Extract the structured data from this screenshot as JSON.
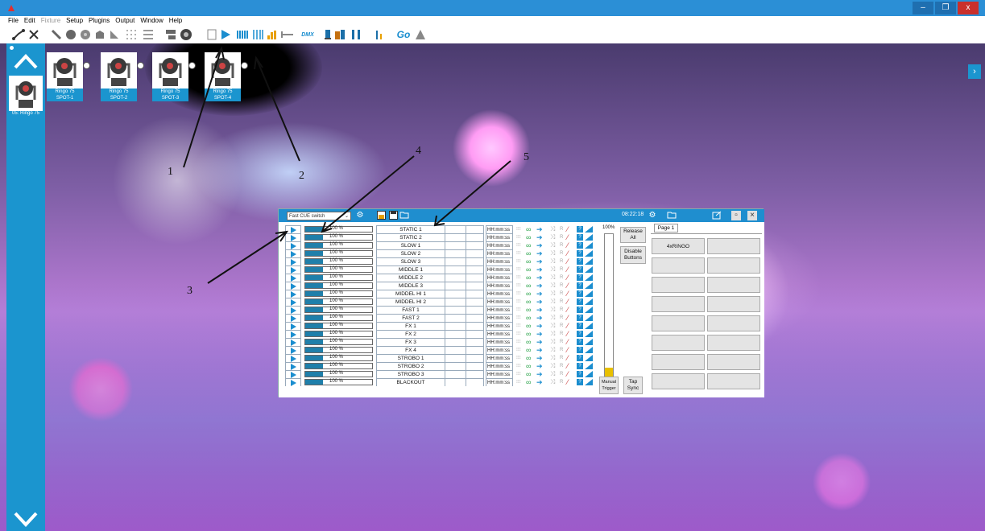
{
  "menu": [
    "File",
    "Edit",
    "Fixture",
    "Setup",
    "Plugins",
    "Output",
    "Window",
    "Help"
  ],
  "menu_disabled": [
    "Fixture"
  ],
  "window_controls": [
    "–",
    "❐",
    "x"
  ],
  "toolbar": {
    "dmx_label": "DMX",
    "go_label": "Go"
  },
  "sidebar": {
    "thumb_label": "05: Ringo 75"
  },
  "fixtures": [
    {
      "line1": "Ringo 75",
      "line2": "SPOT-1"
    },
    {
      "line1": "Ringo 75",
      "line2": "SPOT-2"
    },
    {
      "line1": "Ringo 75",
      "line2": "SPOT-3"
    },
    {
      "line1": "Ringo 75",
      "line2": "SPOT-4"
    }
  ],
  "annotations": [
    "1",
    "2",
    "3",
    "4",
    "5"
  ],
  "cue_window": {
    "mode": "Fast CUE switch",
    "clock": "08:22:18",
    "master_pct": "100%",
    "master_level": 0.16,
    "release_all": "Release All",
    "disable_buttons": "Disable Buttons",
    "manual_trigger": "Manual Trigger",
    "tap_sync": "Tap Sync",
    "page_tab": "Page 1",
    "time_placeholder": "HH:mm:ss",
    "level_text": "100 %",
    "cues": [
      "STATIC 1",
      "STATIC 2",
      "SLOW 1",
      "SLOW 2",
      "SLOW 3",
      "MIDDLE 1",
      "MIDDLE 2",
      "MIDDLE 3",
      "MIDDEL HI 1",
      "MIDDEL HI 2",
      "FAST 1",
      "FAST 2",
      "FX 1",
      "FX 2",
      "FX 3",
      "FX 4",
      "STROBO 1",
      "STROBO 2",
      "STROBO 3",
      "BLACKOUT"
    ],
    "grid_buttons": [
      "4xRINGO",
      "",
      "",
      "",
      "",
      "",
      "",
      "",
      "",
      "",
      "",
      "",
      "",
      "",
      "",
      "",
      "",
      "",
      "",
      ""
    ]
  }
}
